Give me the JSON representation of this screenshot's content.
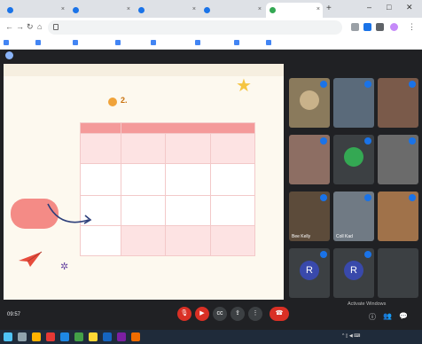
{
  "browser": {
    "tabs": [
      {
        "label": ""
      },
      {
        "label": ""
      },
      {
        "label": ""
      },
      {
        "label": ""
      },
      {
        "label": ""
      }
    ],
    "url": "",
    "bookmarks": [
      "",
      "",
      "",
      "",
      "",
      "",
      "",
      ""
    ],
    "window_controls": {
      "minimize": "–",
      "maximize": "□",
      "close": "✕"
    },
    "nav_icons": [
      "arrow-left-icon",
      "arrow-right-icon",
      "reload-icon",
      "home-icon"
    ]
  },
  "meet": {
    "presenter_banner": "",
    "slide": {
      "title": "",
      "subtitle_num2": "2.",
      "subtitle_item1": "",
      "subtitle_item2": "",
      "standard_line": "",
      "table_header_left": "",
      "table_header_right": "",
      "table_rows": [
        [
          "",
          "",
          "",
          ""
        ],
        [
          "",
          "",
          "",
          ""
        ],
        [
          "",
          "",
          "",
          ""
        ],
        [
          "",
          "",
          "",
          ""
        ]
      ],
      "note_bubble": ""
    },
    "participants": [
      {
        "name": "",
        "color": "#8a7a5c"
      },
      {
        "name": "",
        "color": "#5a6a7a"
      },
      {
        "name": "",
        "color": "#7a5a4a"
      },
      {
        "name": "",
        "color": "#8d6e63"
      },
      {
        "name": "",
        "color": "#34a853",
        "avatar": ""
      },
      {
        "name": "",
        "color": "#6b6b6b"
      },
      {
        "name": "Bee Kelly",
        "color": "#5c4b3a"
      },
      {
        "name": "Coll Kad",
        "color": "#707a84"
      },
      {
        "name": "",
        "color": "#a0724a"
      },
      {
        "name": "",
        "color": "#3949ab",
        "avatar": "R"
      },
      {
        "name": "",
        "color": "#3949ab",
        "avatar": "R"
      },
      {
        "name": "",
        "color": "#3c4043"
      }
    ],
    "clock": "09:57",
    "meeting_code": "",
    "controls": [
      "mic-off-icon",
      "camera-off-icon",
      "captions-icon",
      "present-icon",
      "more-icon",
      "end-call-icon"
    ],
    "activate_windows": "Activate Windows",
    "activate_hint": ""
  },
  "taskbar": {
    "lang": "",
    "time": "",
    "date": ""
  }
}
